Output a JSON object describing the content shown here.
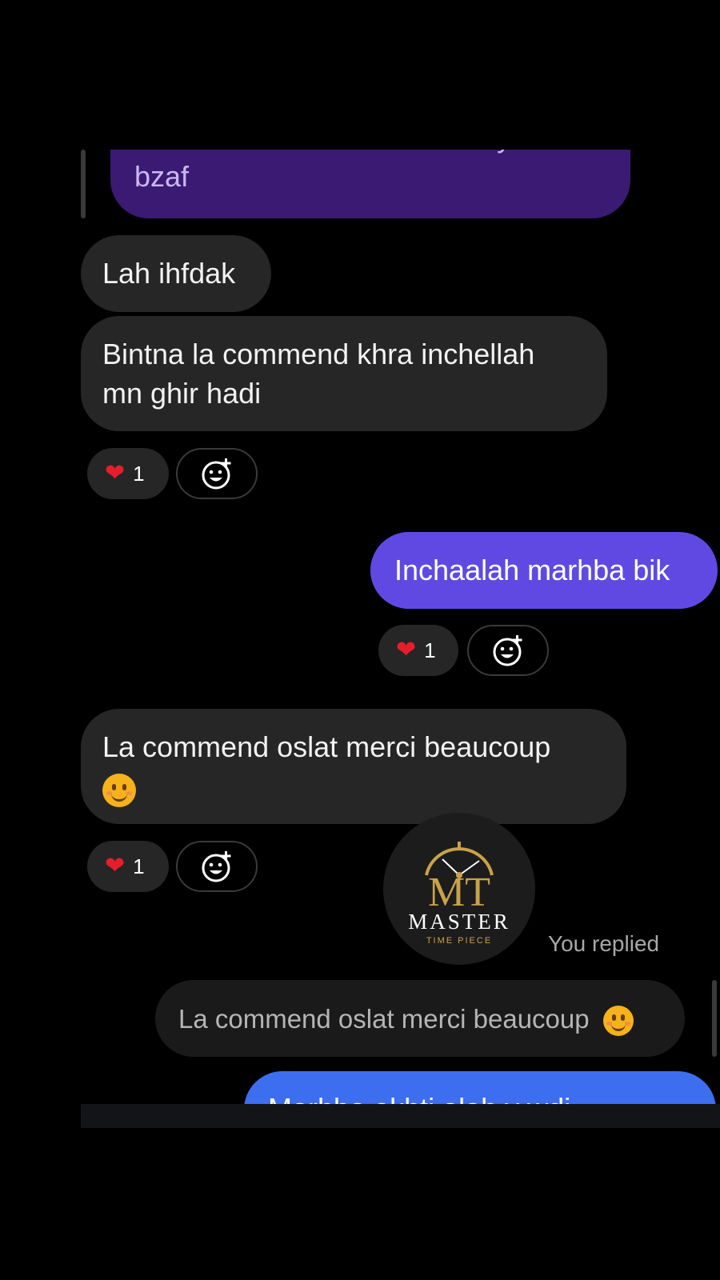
{
  "messages": {
    "m0_partial_line": "Thanks dorna l'commande dyalk nbar",
    "m0_last_line": "bzaf",
    "m1": "Lah ihfdak",
    "m2_line1": "Bintna la commend khra inchellah",
    "m2_line2": "mn ghir hadi",
    "m3": "Inchaalah marhba bik",
    "m4": "La commend oslat merci beaucoup",
    "m4_emoji": "smiling-face-with-smiling-eyes",
    "replied_label": "You replied",
    "quoted": "La commend oslat merci beaucoup",
    "m5_partial": "Marhba okhti alah y wdi"
  },
  "reactions": {
    "r1": {
      "emoji": "heart",
      "count": "1"
    },
    "r2": {
      "emoji": "heart",
      "count": "1"
    },
    "r3": {
      "emoji": "heart",
      "count": "1"
    }
  },
  "watermark": {
    "monogram": "MT",
    "brand": "MASTER",
    "tagline": "TIME PIECE"
  },
  "icons": {
    "heart": "red-heart-emoji",
    "add_reaction": "add-reaction-icon",
    "smile": "smiling-face-emoji"
  },
  "colors": {
    "background": "#000000",
    "incoming_bubble": "#262626",
    "outgoing_purple": "#6049e3",
    "outgoing_top": "#3a1a73",
    "outgoing_blue": "#3d6ef0",
    "logo_gold": "#c9a24a"
  }
}
